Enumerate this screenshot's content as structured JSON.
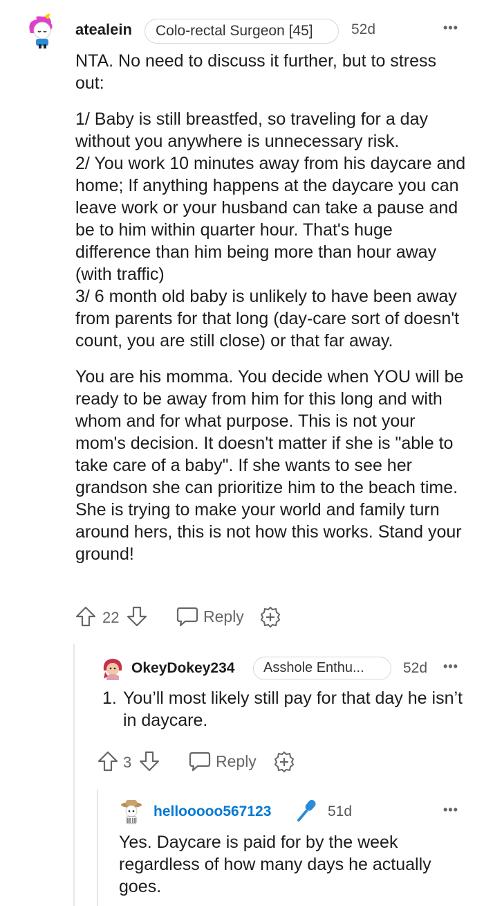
{
  "comment1": {
    "username": "atealein",
    "flair": "Colo-rectal Surgeon [45]",
    "age": "52d",
    "more": "•••",
    "paragraphs": [
      "NTA. No need to discuss it further, but to stress out:",
      "1/ Baby is still breastfed, so traveling for a day without you anywhere is unnecessary risk.\n2/ You work 10 minutes away from his daycare and home; If anything happens at the daycare you can leave work or your husband can take a pause and be to him within quarter hour. That's huge difference than him being more than hour away (with traffic)\n3/ 6 month old baby is unlikely to have been away from parents for that long (day-care sort of doesn't count, you are still close) or that far away.",
      "You are his momma. You decide when YOU will be ready to be away from him for this long and with whom and for what purpose. This is not your mom's decision. It doesn't matter if she is \"able to take care of a baby\". If she wants to see her grandson she can prioritize him to the beach time. She is trying to make your world and family turn around hers, this is not how this works. Stand your ground!"
    ],
    "votes": "22",
    "reply_label": "Reply"
  },
  "comment2": {
    "username": "OkeyDokey234",
    "flair": "Asshole Enthu...",
    "age": "52d",
    "more": "•••",
    "list_number": "1.",
    "list_text": "You’ll most likely still pay for that day he isn’t in daycare.",
    "votes": "3",
    "reply_label": "Reply"
  },
  "comment3": {
    "username": "hellooooo567123",
    "age": "51d",
    "more": "•••",
    "text": "Yes. Daycare is paid for by the week regardless of how many days he actually goes."
  },
  "icons": {
    "upvote": "upvote-arrow-icon",
    "downvote": "downvote-arrow-icon",
    "reply": "speech-bubble-icon",
    "award": "plus-circle-icon",
    "mic": "microphone-icon"
  },
  "colors": {
    "username_link": "#0079d3",
    "text": "#1c1c1c",
    "muted": "#666666",
    "flair_border": "#d4d7d9",
    "thread_line": "#e6e6e6"
  }
}
